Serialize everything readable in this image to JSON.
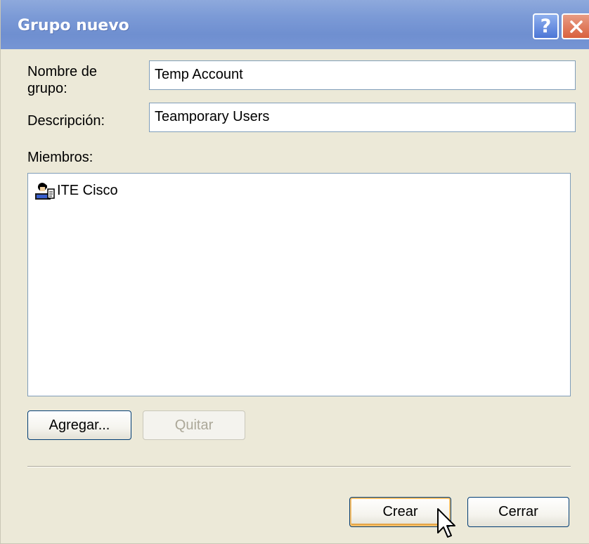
{
  "window": {
    "title": "Grupo nuevo",
    "help_glyph": "?",
    "close_icon": "close-icon"
  },
  "form": {
    "group_name_label": "Nombre de grupo:",
    "group_name_value": "Temp Account",
    "description_label": "Descripción:",
    "description_value": "Teamporary Users",
    "members_label": "Miembros:"
  },
  "members": [
    {
      "name": "ITE Cisco",
      "icon": "user-icon"
    }
  ],
  "buttons": {
    "add": "Agregar...",
    "remove": "Quitar",
    "create": "Crear",
    "close": "Cerrar"
  },
  "colors": {
    "titlebar": "#7b9ad6",
    "dialog_bg": "#ece9d8",
    "field_border": "#7f9db9",
    "close_button": "#d9613e",
    "default_button_highlight": "#f7c06b"
  },
  "cursor": "arrow-pointer-icon"
}
